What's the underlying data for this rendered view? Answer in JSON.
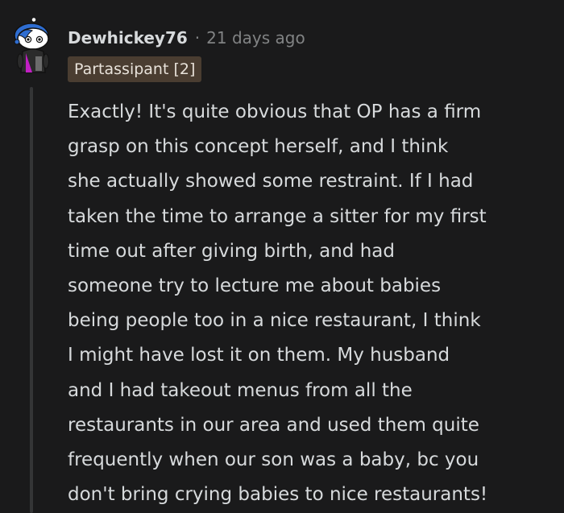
{
  "comment": {
    "author": "Dewhickey76",
    "separator": "·",
    "timestamp": "21 days ago",
    "flair": "Partassipant [2]",
    "body_lines": [
      "Exactly! It's quite obvious that OP has a firm",
      "grasp on this concept herself, and I think",
      "she actually showed some restraint. If I had",
      "taken the time to arrange a sitter for my first",
      "time out after giving birth, and had",
      "someone try to lecture me about babies",
      "being people too in a nice restaurant, I think",
      "I might have lost it on them. My husband",
      "and I had takeout menus from all the",
      "restaurants in our area and used them quite",
      "frequently when our son was a baby, bc you",
      "don't bring crying babies to nice restaurants!"
    ]
  },
  "colors": {
    "background": "#1a1a1b",
    "text": "#d7dadc",
    "meta": "#818384",
    "flair_bg": "#4a3d31",
    "thread_line": "#343536",
    "avatar_blue": "#2e6dd1",
    "avatar_magenta": "#c21fc4"
  },
  "icons": {
    "avatar": "snoo-avatar-icon"
  }
}
